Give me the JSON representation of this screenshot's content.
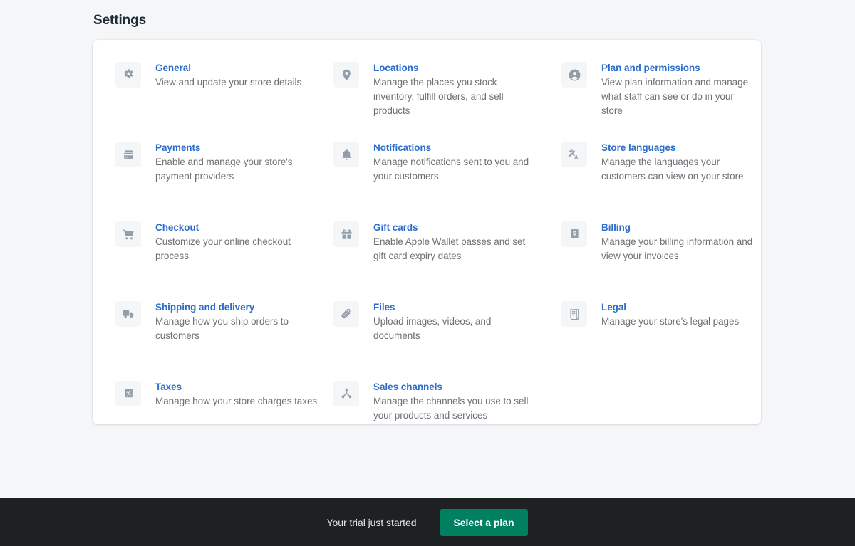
{
  "page": {
    "title": "Settings",
    "background_color": "#f4f6f8",
    "card_background": "#ffffff",
    "link_color": "#2c6ecb",
    "text_color": "#6d7175",
    "title_color": "#212b36"
  },
  "settings": {
    "columns": [
      {
        "items": [
          {
            "icon": "gear-icon",
            "title": "General",
            "description": "View and update your store details"
          },
          {
            "icon": "credit-card-icon",
            "title": "Payments",
            "description": "Enable and manage your store's payment providers"
          },
          {
            "icon": "shopping-cart-icon",
            "title": "Checkout",
            "description": "Customize your online checkout process"
          },
          {
            "icon": "delivery-truck-icon",
            "title": "Shipping and delivery",
            "description": "Manage how you ship orders to customers"
          },
          {
            "icon": "tax-receipt-icon",
            "title": "Taxes",
            "description": "Manage how your store charges taxes"
          }
        ]
      },
      {
        "items": [
          {
            "icon": "location-pin-icon",
            "title": "Locations",
            "description": "Manage the places you stock inventory, fulfill orders, and sell products"
          },
          {
            "icon": "bell-icon",
            "title": "Notifications",
            "description": "Manage notifications sent to you and your customers"
          },
          {
            "icon": "gift-card-icon",
            "title": "Gift cards",
            "description": "Enable Apple Wallet passes and set gift card expiry dates"
          },
          {
            "icon": "paperclip-icon",
            "title": "Files",
            "description": "Upload images, videos, and documents"
          },
          {
            "icon": "sales-channels-icon",
            "title": "Sales channels",
            "description": "Manage the channels you use to sell your products and services"
          }
        ]
      },
      {
        "items": [
          {
            "icon": "person-circle-icon",
            "title": "Plan and permissions",
            "description": "View plan information and manage what staff can see or do in your store"
          },
          {
            "icon": "translate-icon",
            "title": "Store languages",
            "description": "Manage the languages your customers can view on your store"
          },
          {
            "icon": "billing-receipt-icon",
            "title": "Billing",
            "description": "Manage your billing information and view your invoices"
          },
          {
            "icon": "legal-scroll-icon",
            "title": "Legal",
            "description": "Manage your store's legal pages"
          }
        ]
      }
    ]
  },
  "trial_banner": {
    "message": "Your trial just started",
    "button_label": "Select a plan",
    "button_color": "#008060",
    "background_color": "#1f2021"
  }
}
